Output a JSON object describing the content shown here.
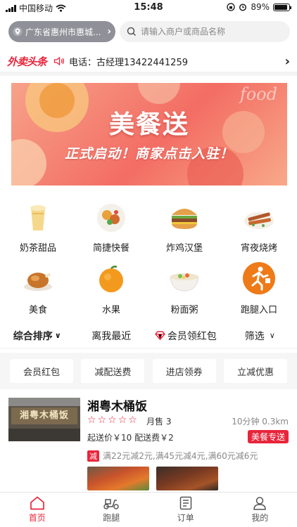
{
  "status_bar": {
    "carrier": "中国移动",
    "time": "15:48",
    "battery": "89%",
    "battery_level": 0.89
  },
  "top_bar": {
    "location": "广东省惠州市惠城...",
    "search_placeholder": "请输入商户或商品名称"
  },
  "news": {
    "logo": "外卖头条",
    "phone_text": "电话：古经理13422441259"
  },
  "banner": {
    "title": "美餐送",
    "subtitle": "正式启动！商家点击入驻！",
    "watermark": "food"
  },
  "categories": [
    {
      "label": "奶茶甜品",
      "icon": "milk-tea-icon"
    },
    {
      "label": "简捷快餐",
      "icon": "fast-food-icon"
    },
    {
      "label": "炸鸡汉堡",
      "icon": "burger-icon"
    },
    {
      "label": "宵夜烧烤",
      "icon": "bbq-icon"
    },
    {
      "label": "美食",
      "icon": "roast-chicken-icon"
    },
    {
      "label": "水果",
      "icon": "orange-icon"
    },
    {
      "label": "粉面粥",
      "icon": "noodle-bowl-icon"
    },
    {
      "label": "跑腿入口",
      "icon": "runner-icon"
    }
  ],
  "sort_bar": {
    "items": [
      "综合排序",
      "离我最近",
      "会员领红包",
      "筛选"
    ]
  },
  "filters": [
    "会员红包",
    "减配送费",
    "进店领券",
    "立减优惠"
  ],
  "shop": {
    "name": "湘粤木桶饭",
    "sign_text": "湘粤木桶饭",
    "sales": "月售 3",
    "time_distance": "10分钟  0.3km",
    "fees": "起送价￥10  配送费￥2",
    "badge": "美餐专送",
    "promo_tag": "减",
    "promo": "满22元减2元,满45元减4元,满60元减6元",
    "rating": 0
  },
  "tabs": [
    {
      "label": "首页",
      "icon": "home-icon"
    },
    {
      "label": "跑腿",
      "icon": "scooter-icon"
    },
    {
      "label": "订单",
      "icon": "order-icon"
    },
    {
      "label": "我的",
      "icon": "person-icon"
    }
  ],
  "colors": {
    "accent": "#e8253b",
    "location_bg": "#8f9098",
    "banner_main": "#f36d64"
  }
}
